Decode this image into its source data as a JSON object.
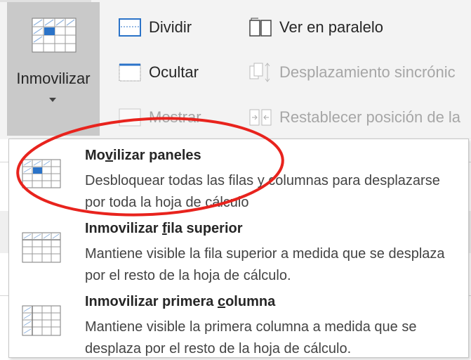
{
  "ribbon": {
    "freeze_button": {
      "label": "Inmovilizar"
    },
    "commands": {
      "split": "Dividir",
      "hide": "Ocultar",
      "show": "Mostrar",
      "side_by_side": "Ver en paralelo",
      "sync_scroll": "Desplazamiento sincrónic",
      "reset_position": "Restablecer posición de la"
    }
  },
  "menu": {
    "items": [
      {
        "title_pre": "Mo",
        "title_u": "v",
        "title_post": "ilizar paneles",
        "description": "Desbloquear todas las filas y columnas para desplazarse por toda la hoja de cálculo"
      },
      {
        "title_pre": "Inmovilizar ",
        "title_u": "f",
        "title_post": "ila superior",
        "description": "Mantiene visible la fila superior a medida que se desplaza por el resto de la hoja de cálculo."
      },
      {
        "title_pre": "Inmovilizar primera ",
        "title_u": "c",
        "title_post": "olumna",
        "description": "Mantiene visible la primera columna a medida que se desplaza por el resto de la hoja de cálculo."
      }
    ]
  },
  "colors": {
    "annotation": "#e8231d",
    "selected_button": "#c9c9c9",
    "icon_blue": "#2b73c8"
  }
}
